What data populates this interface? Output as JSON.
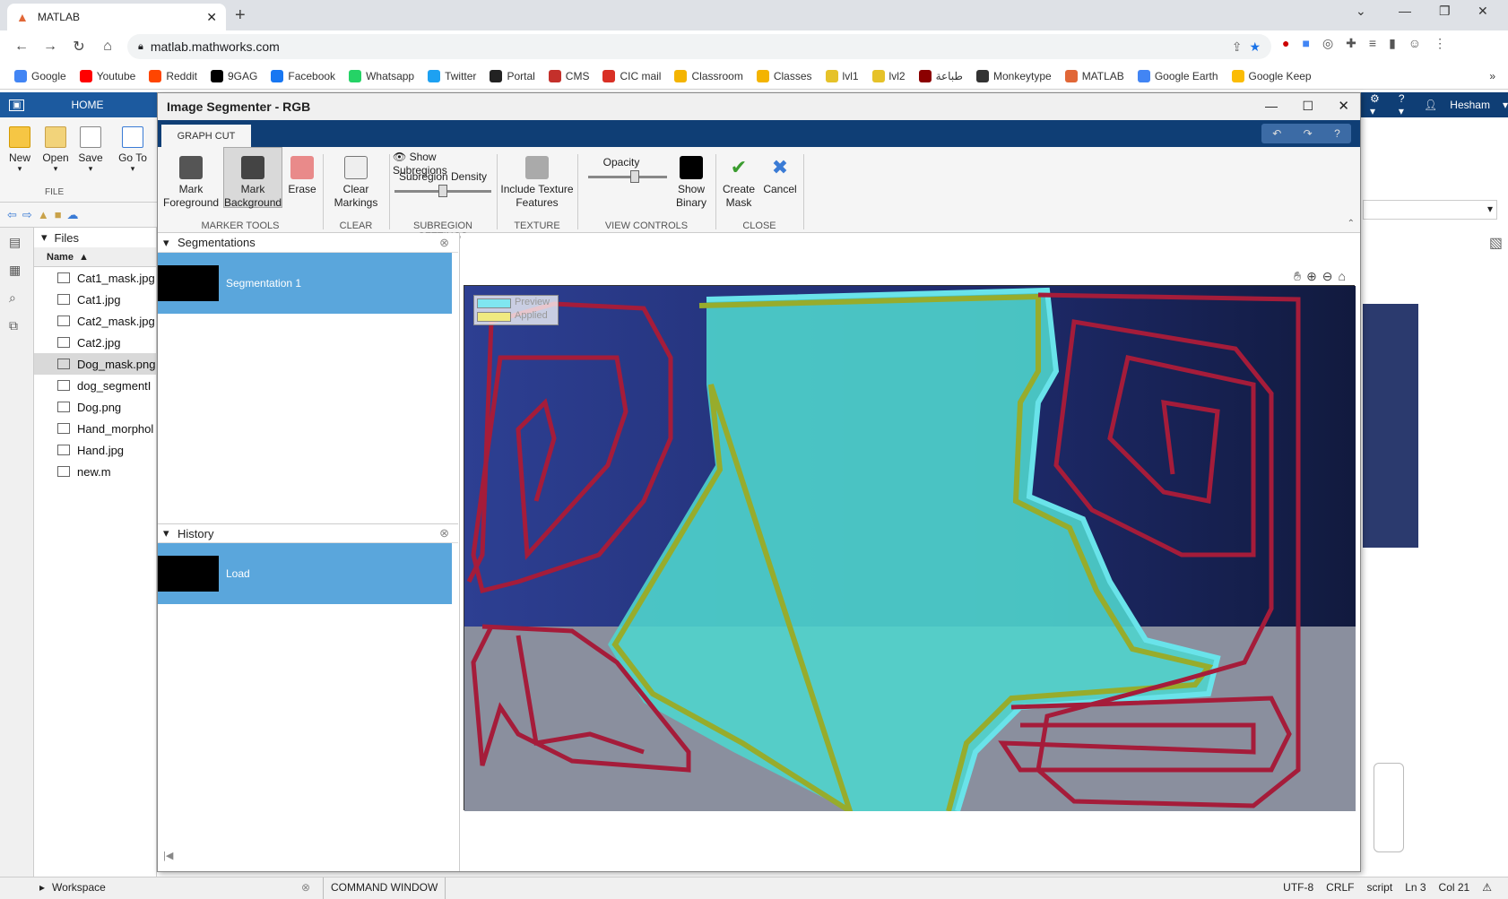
{
  "browser": {
    "tab_title": "MATLAB",
    "url": "matlab.mathworks.com"
  },
  "bookmarks": [
    {
      "label": "Google",
      "color": "#4285f4"
    },
    {
      "label": "Youtube",
      "color": "#ff0000"
    },
    {
      "label": "Reddit",
      "color": "#ff4500"
    },
    {
      "label": "9GAG",
      "color": "#000000"
    },
    {
      "label": "Facebook",
      "color": "#1877f2"
    },
    {
      "label": "Whatsapp",
      "color": "#25d366"
    },
    {
      "label": "Twitter",
      "color": "#1da1f2"
    },
    {
      "label": "Portal",
      "color": "#222222"
    },
    {
      "label": "CMS",
      "color": "#c4302b"
    },
    {
      "label": "CIC mail",
      "color": "#d93025"
    },
    {
      "label": "Classroom",
      "color": "#f4b400"
    },
    {
      "label": "Classes",
      "color": "#f4b400"
    },
    {
      "label": "lvl1",
      "color": "#e6c229"
    },
    {
      "label": "lvl2",
      "color": "#e6c229"
    },
    {
      "label": "طباعة",
      "color": "#8b0000"
    },
    {
      "label": "Monkeytype",
      "color": "#333333"
    },
    {
      "label": "MATLAB",
      "color": "#e16737"
    },
    {
      "label": "Google Earth",
      "color": "#4285f4"
    },
    {
      "label": "Google Keep",
      "color": "#fbbc04"
    }
  ],
  "matlab": {
    "home_tab": "HOME",
    "user": "Hesham",
    "toolstrip": {
      "new": "New",
      "open": "Open",
      "save": "Save",
      "goto": "Go To",
      "file_section": "FILE"
    },
    "files_header": "Files",
    "name_col": "Name",
    "files": [
      "Cat1_mask.jpg",
      "Cat1.jpg",
      "Cat2_mask.jpg",
      "Cat2.jpg",
      "Dog_mask.png",
      "dog_segmentI",
      "Dog.png",
      "Hand_morphol",
      "Hand.jpg",
      "new.m"
    ],
    "workspace": "Workspace",
    "command_window": "COMMAND WINDOW",
    "status": {
      "encoding": "UTF-8",
      "eol": "CRLF",
      "mode": "script",
      "ln": "Ln 3",
      "col": "Col 21"
    }
  },
  "segmenter": {
    "title": "Image Segmenter - RGB",
    "tab": "GRAPH CUT",
    "buttons": {
      "mark_fg": "Mark Foreground",
      "mark_bg": "Mark Background",
      "erase": "Erase",
      "clear": "Clear Markings",
      "show_sub": "Show Subregions",
      "density": "Subregion Density",
      "texture": "Include Texture Features",
      "opacity": "Opacity",
      "show_binary": "Show Binary",
      "create_mask": "Create Mask",
      "cancel": "Cancel"
    },
    "sections": {
      "marker": "MARKER TOOLS",
      "clear": "CLEAR",
      "subregion": "SUBREGION SETTINGS",
      "texture": "TEXTURE",
      "view": "VIEW CONTROLS",
      "close": "CLOSE"
    },
    "segmentations_header": "Segmentations",
    "segmentation_item": "Segmentation 1",
    "history_header": "History",
    "history_item": "Load",
    "legend": {
      "preview": "Preview",
      "applied": "Applied",
      "preview_color": "#7fe6f0",
      "applied_color": "#f0ea80"
    },
    "opacity_level": 0.6,
    "density_level": 0.5
  }
}
